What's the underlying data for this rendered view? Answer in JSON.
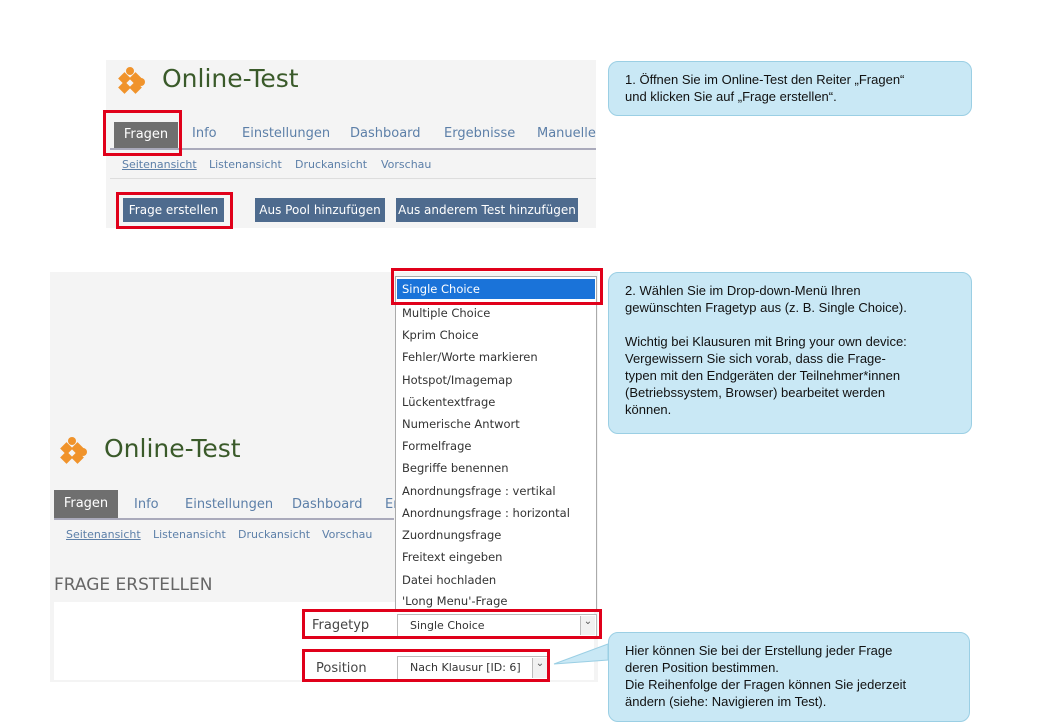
{
  "panel1": {
    "app_title": "Online-Test",
    "tabs": [
      "Fragen",
      "Info",
      "Einstellungen",
      "Dashboard",
      "Ergebnisse",
      "Manuelle"
    ],
    "subtabs": [
      "Seitenansicht",
      "Listenansicht",
      "Druckansicht",
      "Vorschau"
    ],
    "buttons": {
      "create": "Frage erstellen",
      "pool": "Aus Pool hinzufügen",
      "other_test": "Aus anderem Test hinzufügen"
    }
  },
  "panel2": {
    "app_title": "Online-Test",
    "tabs": [
      "Fragen",
      "Info",
      "Einstellungen",
      "Dashboard",
      "Er"
    ],
    "subtabs": [
      "Seitenansicht",
      "Listenansicht",
      "Druckansicht",
      "Vorschau"
    ],
    "heading": "FRAGE ERSTELLEN",
    "dropdown_options": [
      "Single Choice",
      "Multiple Choice",
      "Kprim Choice",
      "Fehler/Worte markieren",
      "Hotspot/Imagemap",
      "Lückentextfrage",
      "Numerische Antwort",
      "Formelfrage",
      "Begriffe benennen",
      "Anordnungsfrage : vertikal",
      "Anordnungsfrage : horizontal",
      "Zuordnungsfrage",
      "Freitext eingeben",
      "Datei hochladen",
      "'Long Menu'-Frage"
    ],
    "fragetyp_label": "Fragetyp",
    "fragetyp_value": "Single Choice",
    "position_label": "Position",
    "position_value": "Nach Klausur [ID: 6]"
  },
  "callouts": {
    "step1": "1. Öffnen Sie im Online-Test den Reiter „Fragen“\nund klicken Sie auf „Frage erstellen“.",
    "step2_a": "2. Wählen Sie im Drop-down-Menü Ihren\ngewünschten Fragetyp aus (z. B. Single Choice).",
    "step2_b": "Wichtig bei Klausuren mit Bring your own device:\nVergewissern Sie sich vorab, dass die Frage-\ntypen mit den Endgeräten der Teilnehmer*innen\n(Betriebssystem, Browser) bearbeitet werden\nkönnen.",
    "step3": "Hier können Sie bei der Erstellung jeder Frage\nderen Position bestimmen.\nDie Reihenfolge der Fragen können Sie jederzeit\nändern (siehe: Navigieren im Test)."
  },
  "colors": {
    "highlight_red": "#e0001a",
    "button_blue": "#4e6b8e",
    "selected_blue": "#1a73d9",
    "callout_bg": "#c9e8f5",
    "logo_orange": "#f0932b"
  }
}
